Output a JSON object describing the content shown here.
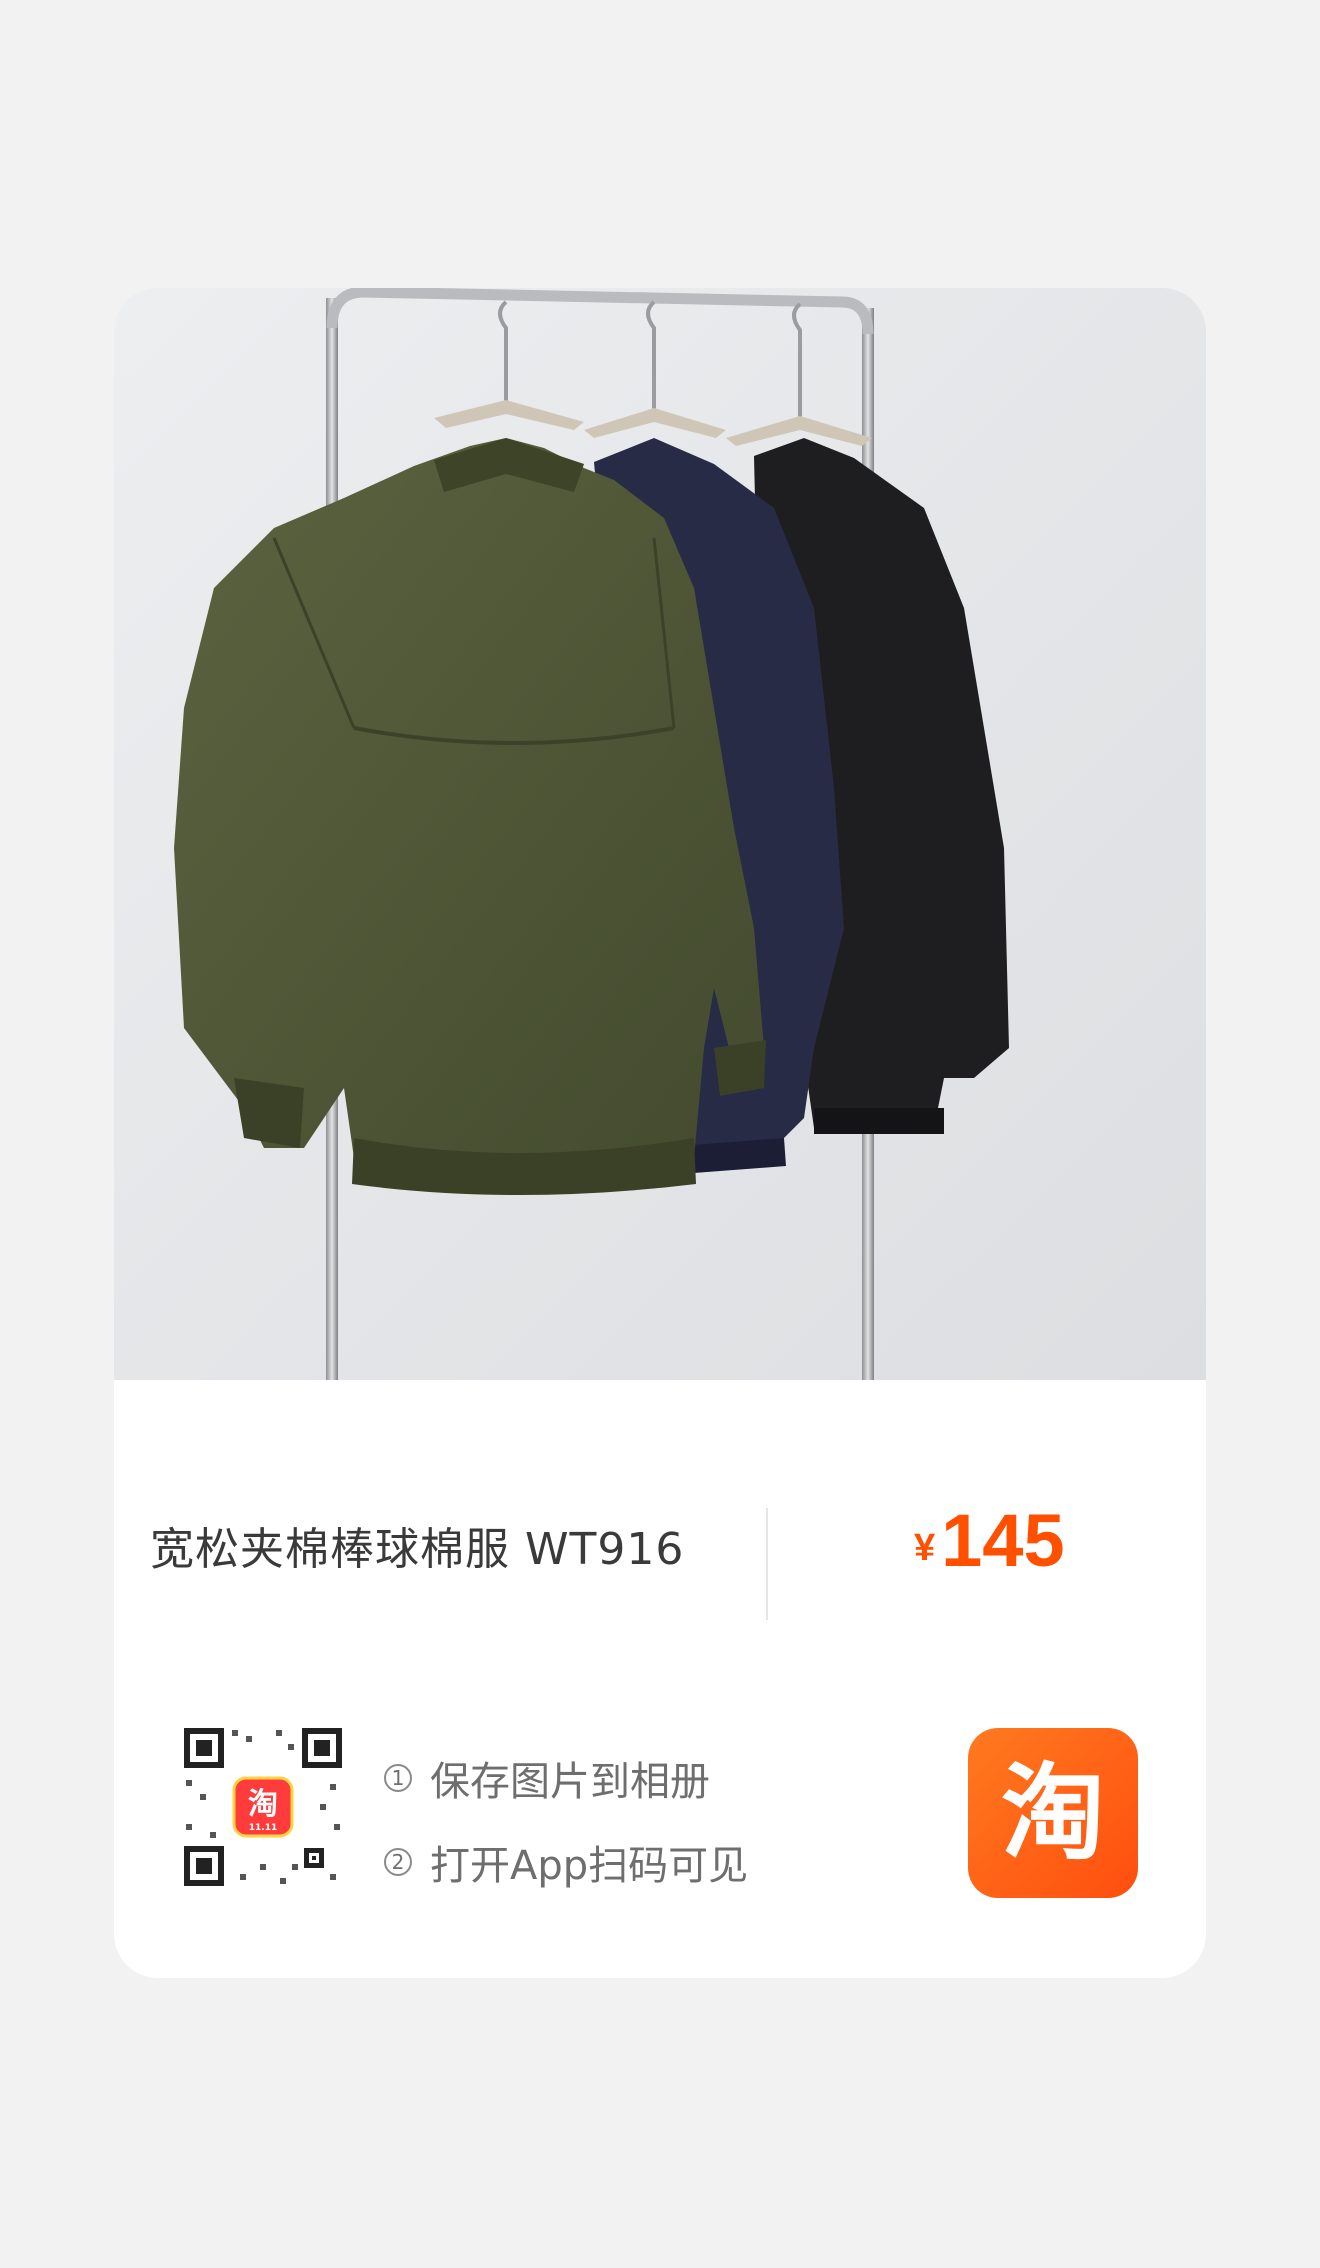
{
  "product": {
    "title": "宽松夹棉棒球棉服 WT916",
    "currency": "¥",
    "price": "145",
    "image_alt": "three bomber jackets on hangers: olive green, navy, black"
  },
  "share": {
    "steps": [
      {
        "num": "1",
        "text": "保存图片到相册"
      },
      {
        "num": "2",
        "text": "打开App扫码可见"
      }
    ],
    "qr_badge": "淘",
    "qr_badge_sub": "11.11",
    "app_icon_glyph": "淘"
  },
  "colors": {
    "accent": "#ff5000",
    "app_icon": "#ff5a14",
    "jacket_olive": "#4f5637",
    "jacket_navy": "#272b45",
    "jacket_black": "#1e1e20"
  }
}
